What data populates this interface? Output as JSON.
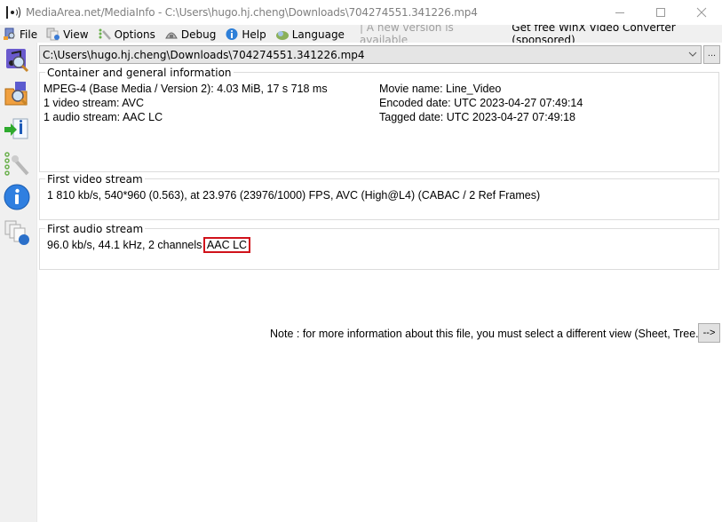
{
  "window": {
    "title": "MediaArea.net/MediaInfo - C:\\Users\\hugo.hj.cheng\\Downloads\\704274551.341226.mp4",
    "controls": {
      "minimize": "minimize",
      "maximize": "maximize",
      "close": "close"
    }
  },
  "menubar": {
    "items": [
      {
        "label": "File",
        "icon": "file-icon"
      },
      {
        "label": "View",
        "icon": "view-icon"
      },
      {
        "label": "Options",
        "icon": "options-icon"
      },
      {
        "label": "Debug",
        "icon": "debug-icon"
      },
      {
        "label": "Help",
        "icon": "help-icon"
      },
      {
        "label": "Language",
        "icon": "language-icon"
      }
    ],
    "update_notice": "| A new version is available",
    "sponsor_link": "Get free WinX Video Converter (sponsored)"
  },
  "sidebar": {
    "buttons": [
      {
        "name": "open-file",
        "icon": "music-file-search-icon"
      },
      {
        "name": "open-folder",
        "icon": "folder-search-icon"
      },
      {
        "name": "export",
        "icon": "export-info-icon"
      },
      {
        "name": "preferences",
        "icon": "wrench-settings-icon"
      },
      {
        "name": "about",
        "icon": "info-icon"
      },
      {
        "name": "web",
        "icon": "documents-web-icon"
      }
    ]
  },
  "file_selector": {
    "value": "C:\\Users\\hugo.hj.cheng\\Downloads\\704274551.341226.mp4",
    "more_label": "..."
  },
  "general": {
    "title": "Container and general information",
    "left": [
      "MPEG-4 (Base Media / Version 2): 4.03 MiB, 17 s 718 ms",
      "1 video stream: AVC",
      "1 audio stream: AAC LC"
    ],
    "right": [
      "Movie name: Line_Video",
      "Encoded date: UTC 2023-04-27 07:49:14",
      "Tagged date: UTC 2023-04-27 07:49:18"
    ]
  },
  "video": {
    "title": "First video stream",
    "line": "1 810 kb/s, 540*960 (0.563), at 23.976 (23976/1000) FPS, AVC (High@L4) (CABAC / 2 Ref Frames)"
  },
  "audio": {
    "title": "First audio stream",
    "line_prefix": "96.0 kb/s, 44.1 kHz, 2 channels",
    "highlighted": "AAC LC",
    "highlight_color": "#d0121b"
  },
  "note": {
    "text": "Note : for more information about this file, you must select a different view (Sheet, Tree...)",
    "button_label": "-->"
  }
}
